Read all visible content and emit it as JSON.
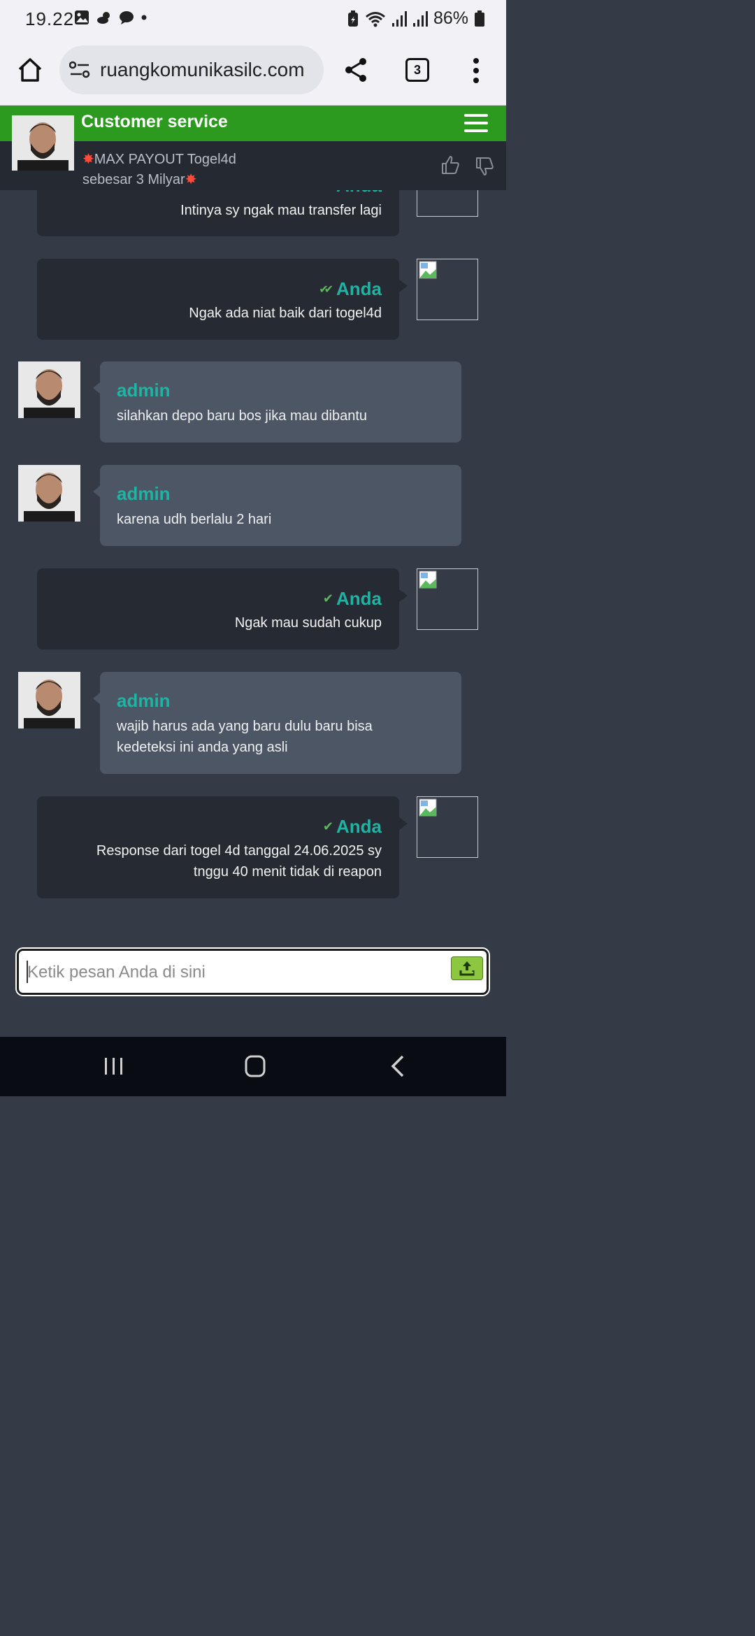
{
  "status_bar": {
    "time": "19.22",
    "battery": "86%"
  },
  "browser": {
    "url": "ruangkomunikasilc.com",
    "tab_count": "3"
  },
  "header": {
    "title": "Customer service",
    "promo_line1": "MAX PAYOUT Togel4d",
    "promo_line2": "sebesar 3 Milyar"
  },
  "messages": [
    {
      "sender": "you",
      "name": "Anda",
      "text": [
        "Intinya sy ngak mau transfer lagi"
      ],
      "read": true
    },
    {
      "sender": "you",
      "name": "Anda",
      "text": [
        "Ngak ada niat baik dari togel4d"
      ],
      "read": true
    },
    {
      "sender": "admin",
      "name": "admin",
      "text": [
        "silahkan depo baru bos jika mau dibantu"
      ]
    },
    {
      "sender": "admin",
      "name": "admin",
      "text": [
        "karena udh berlalu 2 hari"
      ]
    },
    {
      "sender": "you",
      "name": "Anda",
      "text": [
        "Ngak mau sudah cukup"
      ],
      "read": false
    },
    {
      "sender": "admin",
      "name": "admin",
      "text": [
        "wajib harus ada yang baru dulu baru bisa",
        "kedeteksi ini anda yang asli"
      ]
    },
    {
      "sender": "you",
      "name": "Anda",
      "text": [
        "Response dari togel 4d tanggal 24.06.2025 sy",
        "tnggu 40 menit tidak di reapon"
      ],
      "read": false
    }
  ],
  "composer": {
    "placeholder": "Ketik pesan Anda di sini"
  },
  "colors": {
    "header_green": "#2c9a1f",
    "accent_teal": "#1fb3a3",
    "send_button": "#8dc63f"
  }
}
